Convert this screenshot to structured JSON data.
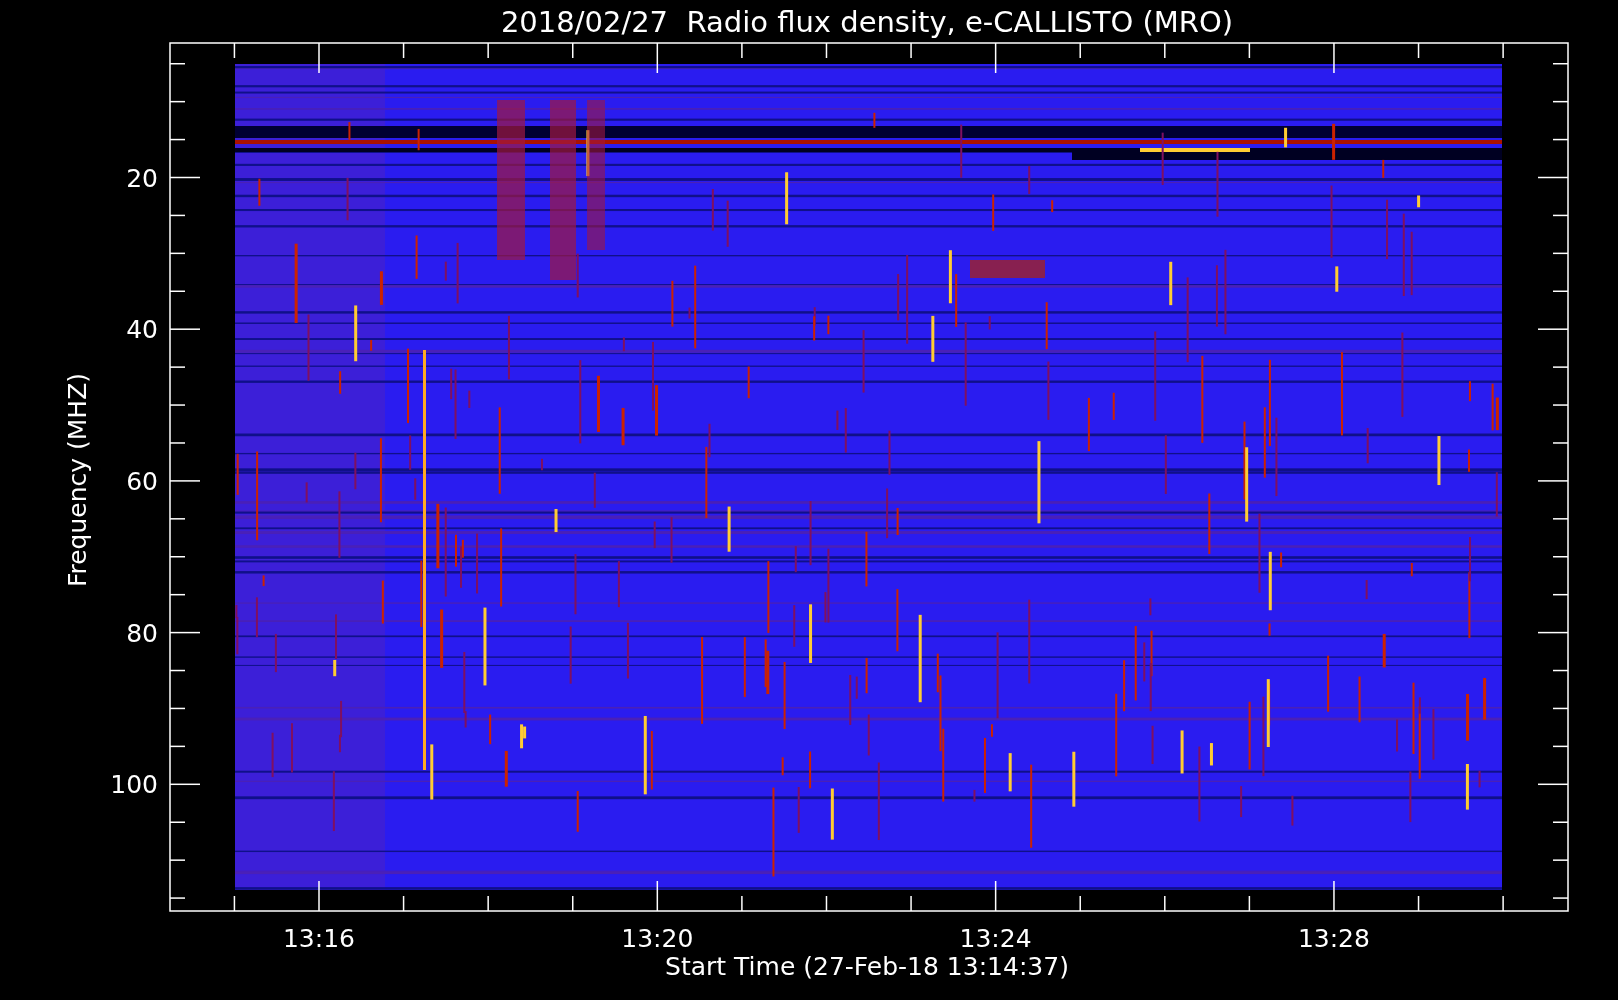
{
  "title": "2018/02/27  Radio flux density, e-CALLISTO (MRO)",
  "ylabel": "Frequency (MHZ)",
  "xlabel": "Start Time (27-Feb-18 13:14:37)",
  "yticks": [
    "20",
    "40",
    "60",
    "80",
    "100"
  ],
  "xticks": [
    "13:16",
    "13:20",
    "13:24",
    "13:28"
  ]
}
